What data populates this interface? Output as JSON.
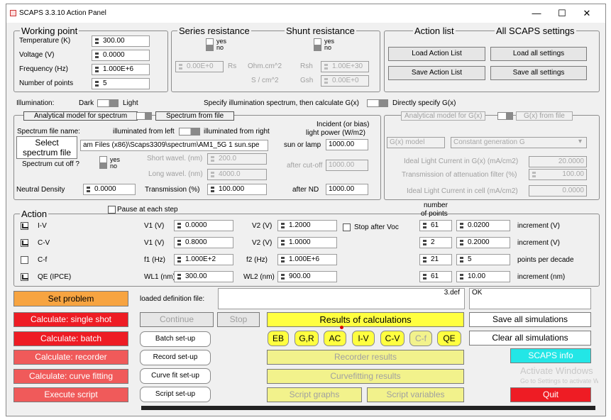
{
  "window": {
    "title": "SCAPS 3.3.10 Action Panel",
    "minimize": "—",
    "maximize": "☐",
    "close": "✕"
  },
  "working_point": {
    "legend": "Working point",
    "temperature_label": "Temperature (K)",
    "temperature": "300.00",
    "voltage_label": "Voltage (V)",
    "voltage": "0.0000",
    "frequency_label": "Frequency (Hz)",
    "frequency": "1.000E+6",
    "points_label": "Number of points",
    "points": "5"
  },
  "series": {
    "legend": "Series resistance",
    "yes": "yes",
    "no": "no",
    "value": "0.00E+0",
    "rs": "Rs",
    "unit1": "Ohm.cm^2",
    "unit2": "S / cm^2"
  },
  "shunt": {
    "legend": "Shunt resistance",
    "yes": "yes",
    "no": "no",
    "rsh": "Rsh",
    "gsh": "Gsh",
    "rsh_value": "1.00E+30",
    "gsh_value": "0.00E+0"
  },
  "action_list": {
    "legend": "Action list",
    "load": "Load Action List",
    "save": "Save Action List"
  },
  "all_settings": {
    "legend": "All SCAPS settings",
    "load": "Load all settings",
    "save": "Save all settings"
  },
  "illumination": {
    "label": "Illumination:",
    "dark": "Dark",
    "light": "Light",
    "spec_text": "Specify illumination spectrum, then calculate G(x)",
    "direct": "Directly specify G(x)"
  },
  "spectrum": {
    "tab_model": "Analytical model for spectrum",
    "tab_file": "Spectrum from file",
    "file_name_label": "Spectrum file name:",
    "illum_left": "illuminated from left",
    "illum_right": "illuminated from right",
    "incident_label": "Incident (or bias)",
    "light_power_label": "light power (W/m2)",
    "select_btn_l1": "Select",
    "select_btn_l2": "spectrum file",
    "file_path": "am Files (x86)\\Scaps3309\\spectrum\\AM1_5G 1 sun.spe",
    "sun_label": "sun or lamp",
    "sun_value": "1000.00",
    "cutoff_label": "Spectrum cut off ?",
    "yes": "yes",
    "no": "no",
    "short_label": "Short wavel. (nm)",
    "short_value": "200.0",
    "long_label": "Long wavel. (nm)",
    "long_value": "4000.0",
    "after_cutoff_label": "after cut-off",
    "after_cutoff_value": "1000.00",
    "nd_label": "Neutral Density",
    "nd_value": "0.0000",
    "trans_label": "Transmission (%)",
    "trans_value": "100.000",
    "after_nd_label": "after ND",
    "after_nd_value": "1000.00"
  },
  "gx": {
    "tab_model": "Analytical model for G(x)",
    "tab_file": "G(x) from file",
    "model_label": "G(x) model",
    "model_value": "Constant generation G",
    "ideal_label": "Ideal Light Current in G(x) (mA/cm2)",
    "ideal_value": "20.0000",
    "trans_label": "Transmission of attenuation filter (%)",
    "trans_value": "100.00",
    "cell_label": "Ideal Light Current in cell (mA/cm2)",
    "cell_value": "0.0000"
  },
  "action": {
    "legend": "Action",
    "pause": "Pause at each step",
    "number_of_points_l1": "number",
    "number_of_points_l2": "of points",
    "stop_after_voc": "Stop after Voc",
    "rows": [
      {
        "name": "I-V",
        "checked": true,
        "v1_label": "V1 (V)",
        "v1": "0.0000",
        "v2_label": "V2 (V)",
        "v2": "1.2000",
        "points": "61",
        "step": "0.0200",
        "unit": "increment (V)"
      },
      {
        "name": "C-V",
        "checked": true,
        "v1_label": "V1 (V)",
        "v1": "0.8000",
        "v2_label": "V2 (V)",
        "v2": "1.0000",
        "points": "2",
        "step": "0.2000",
        "unit": "increment (V)"
      },
      {
        "name": "C-f",
        "checked": false,
        "v1_label": "f1 (Hz)",
        "v1": "1.000E+2",
        "v2_label": "f2 (Hz)",
        "v2": "1.000E+6",
        "points": "21",
        "step": "5",
        "unit": "points per decade"
      },
      {
        "name": "QE (IPCE)",
        "checked": true,
        "v1_label": "WL1 (nm)",
        "v1": "300.00",
        "v2_label": "WL2 (nm)",
        "v2": "900.00",
        "points": "61",
        "step": "10.00",
        "unit": "increment (nm)"
      }
    ]
  },
  "controls": {
    "set_problem": "Set problem",
    "loaded_label": "loaded definition file:",
    "def_file": "3.def",
    "status": "OK",
    "calc_single": "Calculate: single shot",
    "calc_batch": "Calculate: batch",
    "calc_recorder": "Calculate: recorder",
    "calc_curve": "Calculate: curve fitting",
    "exec_script": "Execute script",
    "continue": "Continue",
    "stop": "Stop",
    "batch_setup": "Batch set-up",
    "record_setup": "Record set-up",
    "curvefit_setup": "Curve fit set-up",
    "script_setup": "Script set-up",
    "results": "Results of calculations",
    "eb": "EB",
    "gr": "G,R",
    "ac": "AC",
    "iv": "I-V",
    "cv": "C-V",
    "cf": "C-f",
    "qe": "QE",
    "recorder_results": "Recorder results",
    "curvefit_results": "Curvefitting results",
    "script_graphs": "Script graphs",
    "script_vars": "Script variables",
    "save_all": "Save all simulations",
    "clear_all": "Clear all simulations",
    "scaps_info": "SCAPS info",
    "quit": "Quit",
    "activate_l1": "Activate Windows",
    "activate_l2": "Go to Settings to activate Windows."
  },
  "colors": {
    "orange": "#f7a441",
    "red": "#ee1c24",
    "pink": "#f05a5a",
    "yellow": "#ffff40",
    "pale_yellow": "#f2f28c",
    "cyan": "#23e6e6"
  }
}
